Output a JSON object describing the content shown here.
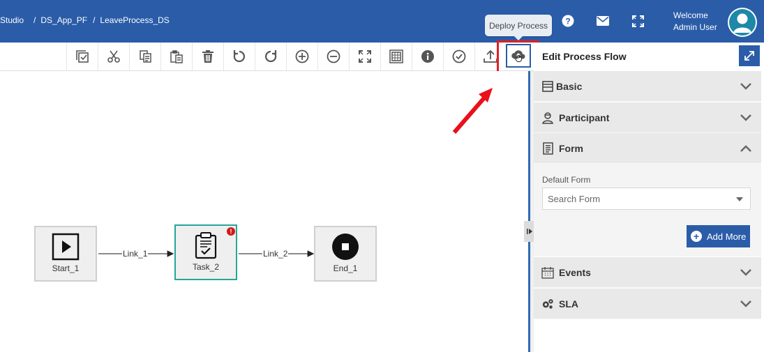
{
  "header": {
    "breadcrumbs": [
      "Studio",
      "DS_App_PF",
      "LeaveProcess_DS"
    ],
    "separator": "/",
    "welcome_line1": "Welcome",
    "welcome_line2": "Admin User",
    "icons": [
      "help-icon",
      "mail-icon",
      "fullscreen-icon",
      "avatar"
    ],
    "tooltip": "Deploy Process",
    "brand_color": "#2a5ca8"
  },
  "toolbar": {
    "buttons": [
      "validate-icon",
      "cut-icon",
      "copy-icon",
      "paste-icon",
      "delete-icon",
      "undo-icon",
      "redo-icon",
      "zoom-in-icon",
      "zoom-out-icon",
      "fit-screen-icon",
      "grid-icon",
      "info-icon",
      "check-icon",
      "upload-icon"
    ],
    "deploy_button": "cloud-deploy-icon"
  },
  "canvas": {
    "nodes": [
      {
        "id": "start",
        "label": "Start_1",
        "icon": "play-icon"
      },
      {
        "id": "task",
        "label": "Task_2",
        "icon": "clipboard-check-icon",
        "error_badge": "!"
      },
      {
        "id": "end",
        "label": "End_1",
        "icon": "stop-icon"
      }
    ],
    "links": [
      {
        "label": "Link_1"
      },
      {
        "label": "Link_2"
      }
    ]
  },
  "panel": {
    "title": "Edit Process Flow",
    "sections": [
      {
        "label": "Basic",
        "icon": "basic-icon",
        "state": "collapsed"
      },
      {
        "label": "Participant",
        "icon": "participant-icon",
        "state": "collapsed"
      },
      {
        "label": "Form",
        "icon": "form-icon",
        "state": "expanded"
      },
      {
        "label": "Events",
        "icon": "calendar-icon",
        "state": "collapsed"
      },
      {
        "label": "SLA",
        "icon": "gears-icon",
        "state": "collapsed"
      }
    ],
    "form": {
      "default_form_label": "Default Form",
      "search_placeholder": "Search Form",
      "add_more_label": "Add More"
    }
  },
  "annotation": {
    "highlight_color": "#e01f25"
  }
}
